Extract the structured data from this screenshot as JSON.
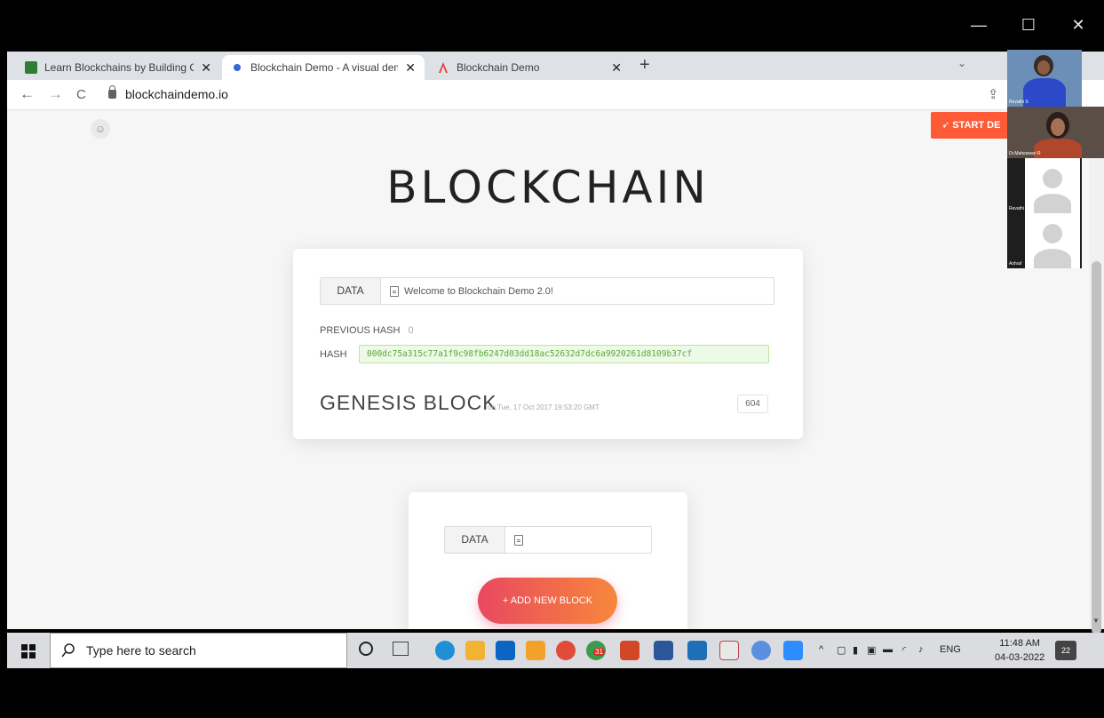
{
  "window": {
    "minimize": "—",
    "maximize": "☐",
    "close": "✕"
  },
  "tabs": [
    {
      "label": "Learn Blockchains by Building O",
      "favicon_color": "#2e7d32",
      "close": "✕"
    },
    {
      "label": "Blockchain Demo - A visual dem",
      "favicon_color": "#3367d6",
      "close": "✕"
    },
    {
      "label": "Blockchain Demo",
      "favicon_color": "#e53935",
      "close": "✕"
    }
  ],
  "browser": {
    "new_tab": "+",
    "tab_menu": "⌄",
    "back": "←",
    "forward": "→",
    "reload": "C",
    "url": "blockchaindemo.io",
    "share": "⇪"
  },
  "page": {
    "start_button": "START DE",
    "title": "BLOCKCHAIN",
    "genesis": {
      "data_label": "DATA",
      "data_value": "Welcome to Blockchain Demo 2.0!",
      "prev_hash_label": "PREVIOUS HASH",
      "prev_hash_value": "0",
      "hash_label": "HASH",
      "hash_value": "000dc75a315c77a1f9c98fb6247d03dd18ac52632d7dc6a9920261d8109b37cf",
      "block_title": "GENESIS BLOCK",
      "block_date": "on Tue, 17 Oct 2017 19:53:20 GMT",
      "nonce": "604"
    },
    "new_block": {
      "data_label": "DATA",
      "data_value": "",
      "add_button": "+  ADD NEW BLOCK"
    }
  },
  "participants": [
    {
      "name": "Revathi S",
      "type": "video"
    },
    {
      "name": "Dr.Maheswari R",
      "type": "video"
    },
    {
      "name": "Revathi",
      "type": "avatar"
    },
    {
      "name": "Ashraf",
      "type": "avatar"
    }
  ],
  "taskbar": {
    "search_placeholder": "Type here to search",
    "language": "ENG",
    "time": "11:48 AM",
    "date": "04-03-2022",
    "notifications": "22",
    "calendar_badge": "31"
  },
  "colors": {
    "accent": "#ff5a36",
    "hash_bg": "#ecfae6",
    "hash_text": "#5aa83a",
    "button_start": "#e9485f",
    "button_end": "#f7873c"
  }
}
